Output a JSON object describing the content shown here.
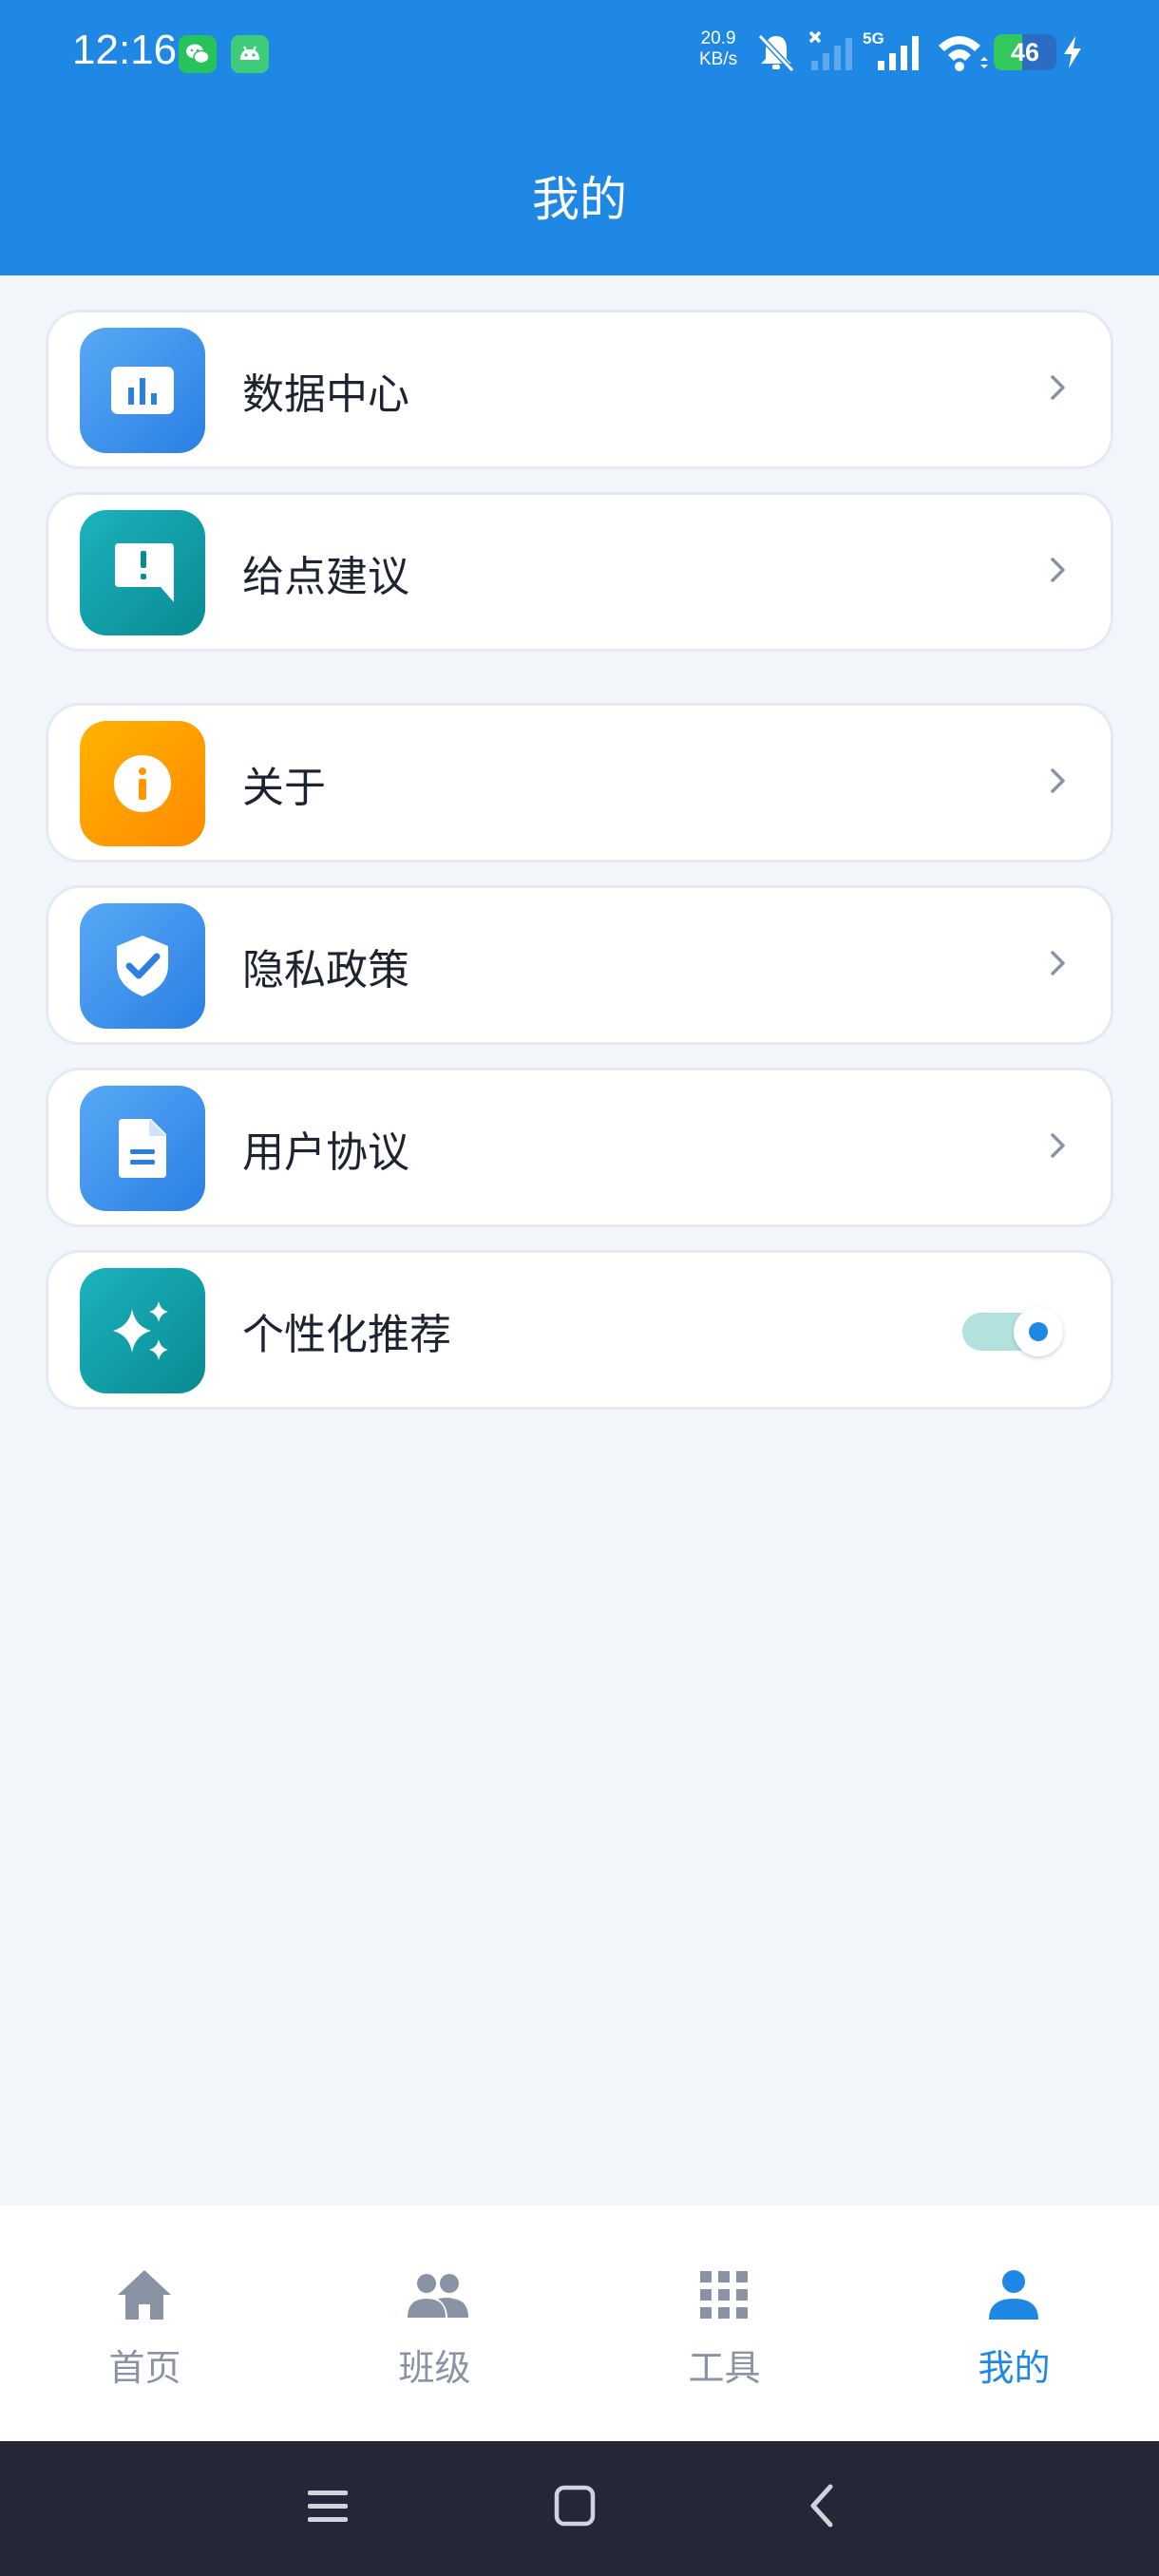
{
  "status_bar": {
    "time": "12:16",
    "net_speed_value": "20.9",
    "net_speed_unit": "KB/s",
    "network_type": "5G",
    "battery_level": "46",
    "battery_fraction": 0.46
  },
  "header": {
    "title": "我的"
  },
  "menu": [
    {
      "label": "数据中心",
      "icon": "bar-chart-icon"
    },
    {
      "label": "给点建议",
      "icon": "feedback-icon"
    },
    {
      "label": "关于",
      "icon": "info-icon"
    },
    {
      "label": "隐私政策",
      "icon": "shield-check-icon"
    },
    {
      "label": "用户协议",
      "icon": "document-icon"
    },
    {
      "label": "个性化推荐",
      "icon": "sparkle-icon",
      "toggle_on": true
    }
  ],
  "tabbar": [
    {
      "label": "首页",
      "icon": "home-icon"
    },
    {
      "label": "班级",
      "icon": "group-icon"
    },
    {
      "label": "工具",
      "icon": "grid-icon"
    },
    {
      "label": "我的",
      "icon": "person-icon",
      "active": true
    }
  ],
  "colors": {
    "primary": "#1f88e5",
    "background": "#f2f6fb",
    "inactive_tab": "#8a93a3",
    "toggle_track": "#b3e2de"
  }
}
